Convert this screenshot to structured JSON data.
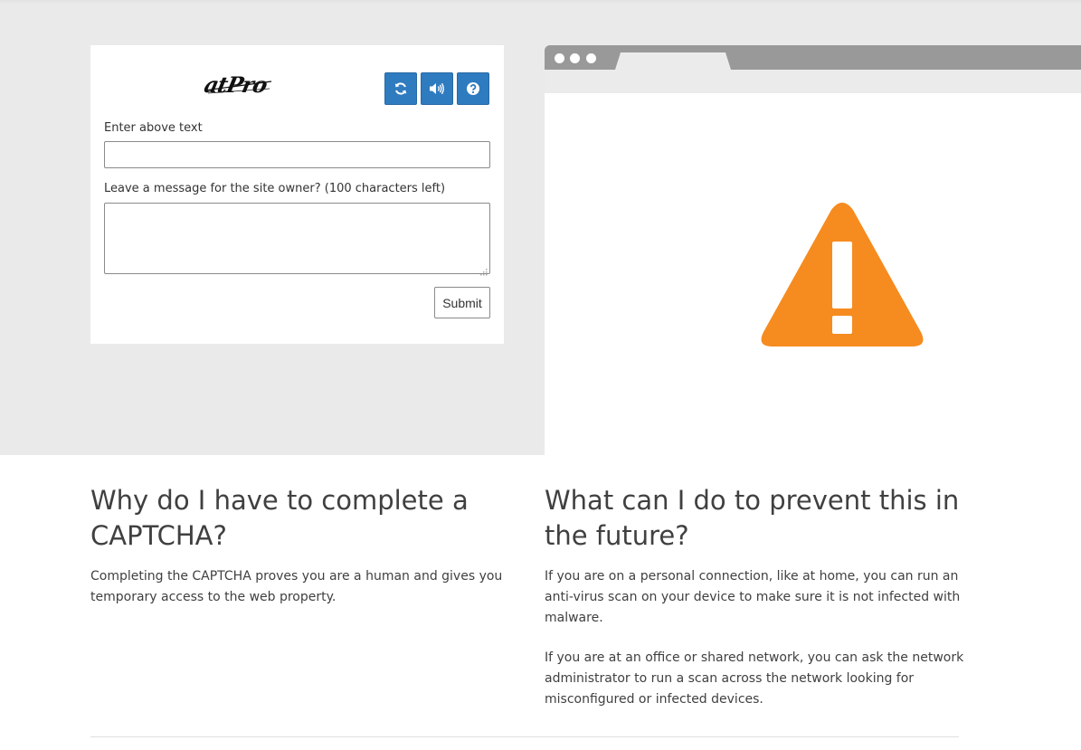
{
  "captcha": {
    "image_text": "atPro",
    "refresh_icon": "refresh-icon",
    "audio_icon": "audio-icon",
    "help_icon": "help-icon",
    "button_color": "#2f7bbf",
    "enter_text_label": "Enter above text",
    "message_label": "Leave a message for the site owner? (100 characters left)",
    "text_input_value": "",
    "message_value": "",
    "submit_label": "Submit"
  },
  "illustration": {
    "warning_icon": "warning-icon",
    "warning_color": "#f68b1f"
  },
  "why": {
    "heading": "Why do I have to complete a CAPTCHA?",
    "body": "Completing the CAPTCHA proves you are a human and gives you temporary access to the web property."
  },
  "prevent": {
    "heading": "What can I do to prevent this in the future?",
    "body_1": "If you are on a personal connection, like at home, you can run an anti-virus scan on your device to make sure it is not infected with malware.",
    "body_2": "If you are at an office or shared network, you can ask the network administrator to run a scan across the network looking for misconfigured or infected devices."
  }
}
